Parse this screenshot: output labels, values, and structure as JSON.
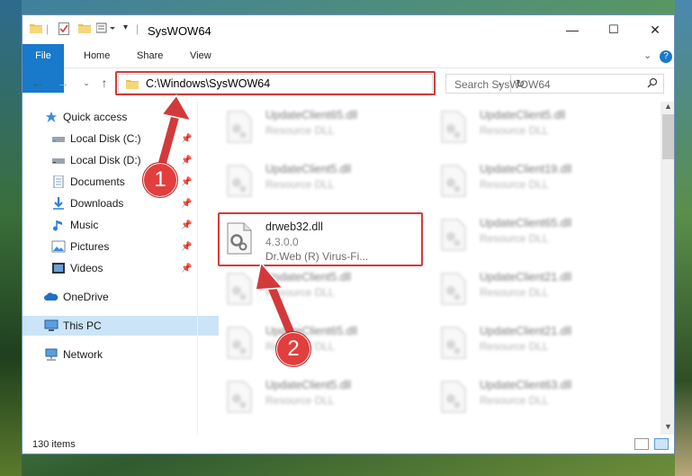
{
  "window": {
    "title": "SysWOW64",
    "controls": {
      "minimize": "—",
      "maximize": "☐",
      "close": "✕"
    }
  },
  "ribbon": {
    "tabs": [
      "File",
      "Home",
      "Share",
      "View"
    ],
    "expand_icon": "chevron-down",
    "help_icon": "help-icon",
    "help_label": "?"
  },
  "nav": {
    "address_path": "C:\\Windows\\SysWOW64",
    "search_placeholder": "Search SysWOW64"
  },
  "sidebar": {
    "items": [
      {
        "label": "Quick access",
        "icon": "star-icon",
        "pinned": false
      },
      {
        "label": "Local Disk (C:)",
        "icon": "drive-icon",
        "pinned": true
      },
      {
        "label": "Local Disk (D:)",
        "icon": "drive-icon",
        "pinned": true
      },
      {
        "label": "Documents",
        "icon": "document-icon",
        "pinned": true
      },
      {
        "label": "Downloads",
        "icon": "download-icon",
        "pinned": true
      },
      {
        "label": "Music",
        "icon": "music-icon",
        "pinned": true
      },
      {
        "label": "Pictures",
        "icon": "pictures-icon",
        "pinned": true
      },
      {
        "label": "Videos",
        "icon": "video-icon",
        "pinned": true
      },
      {
        "label": "OneDrive",
        "icon": "cloud-icon",
        "pinned": false
      },
      {
        "label": "This PC",
        "icon": "computer-icon",
        "pinned": false,
        "selected": true
      },
      {
        "label": "Network",
        "icon": "network-icon",
        "pinned": false
      }
    ]
  },
  "files": {
    "highlighted": {
      "name": "drweb32.dll",
      "version": "4.3.0.0",
      "description": "Dr.Web (R) Virus-Fi..."
    },
    "left_column": [
      {
        "name": "UpdateClient65.dll",
        "type": "Resource DLL"
      },
      {
        "name": "UpdateClient5.dll",
        "type": "Resource DLL"
      },
      {
        "name": "UpdateClient5.dll",
        "type": "Resource DLL"
      },
      {
        "name": "UpdateClient65.dll",
        "type": "Resource DLL"
      },
      {
        "name": "UpdateClient5.dll",
        "type": "Resource DLL"
      }
    ],
    "right_column": [
      {
        "name": "UpdateClient5.dll",
        "type": "Resource DLL"
      },
      {
        "name": "UpdateClient19.dll",
        "type": "Resource DLL"
      },
      {
        "name": "UpdateClient65.dll",
        "type": "Resource DLL"
      },
      {
        "name": "UpdateClient21.dll",
        "type": "Resource DLL"
      },
      {
        "name": "UpdateClient21.dll",
        "type": "Resource DLL"
      },
      {
        "name": "UpdateClient63.dll",
        "type": "Resource DLL"
      }
    ]
  },
  "status": {
    "item_count": "130 items"
  },
  "callouts": {
    "one": "1",
    "two": "2"
  },
  "colors": {
    "accent": "#1979ca",
    "highlight": "#d23a3a",
    "selected": "#cce4f7"
  }
}
